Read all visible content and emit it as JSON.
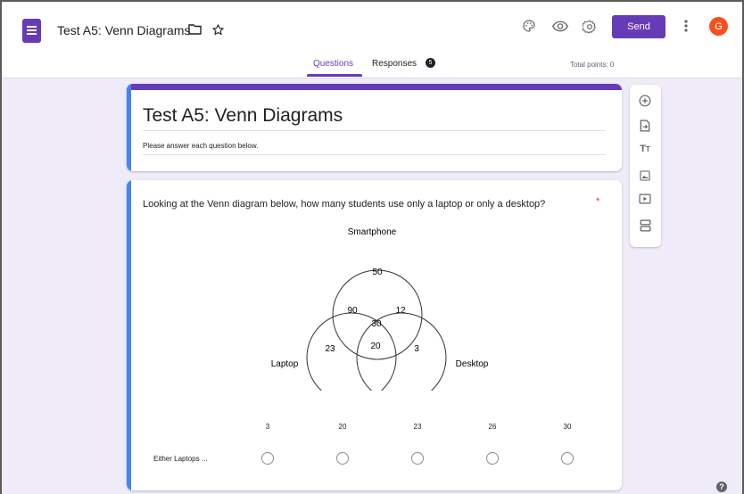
{
  "header": {
    "doc_title": "Test A5: Venn Diagrams",
    "send_label": "Send",
    "avatar_initial": "G",
    "accent_color": "#673ab7"
  },
  "tabs": {
    "questions": "Questions",
    "responses": "Responses",
    "responses_count": "5",
    "total_points": "Total points: 0"
  },
  "form": {
    "title": "Test A5: Venn Diagrams",
    "description": "Please answer each question below."
  },
  "question": {
    "text": "Looking at the Venn diagram below, how many students use only a laptop or only a desktop?",
    "required_mark": "*",
    "venn": {
      "labels": {
        "top": "Smartphone",
        "left": "Laptop",
        "right": "Desktop"
      },
      "regions": {
        "smartphone_only": "50",
        "smartphone_laptop": "90",
        "smartphone_desktop": "12",
        "all_three": "30",
        "laptop_only": "23",
        "laptop_desktop": "20",
        "desktop_only": "3"
      }
    },
    "columns": [
      "3",
      "20",
      "23",
      "26",
      "30"
    ],
    "row_label": "Either Laptops ..."
  },
  "icons": {
    "add": "add-circle-icon",
    "import": "import-icon",
    "title": "title-text-icon",
    "image": "image-icon",
    "video": "video-icon",
    "section": "section-icon"
  }
}
